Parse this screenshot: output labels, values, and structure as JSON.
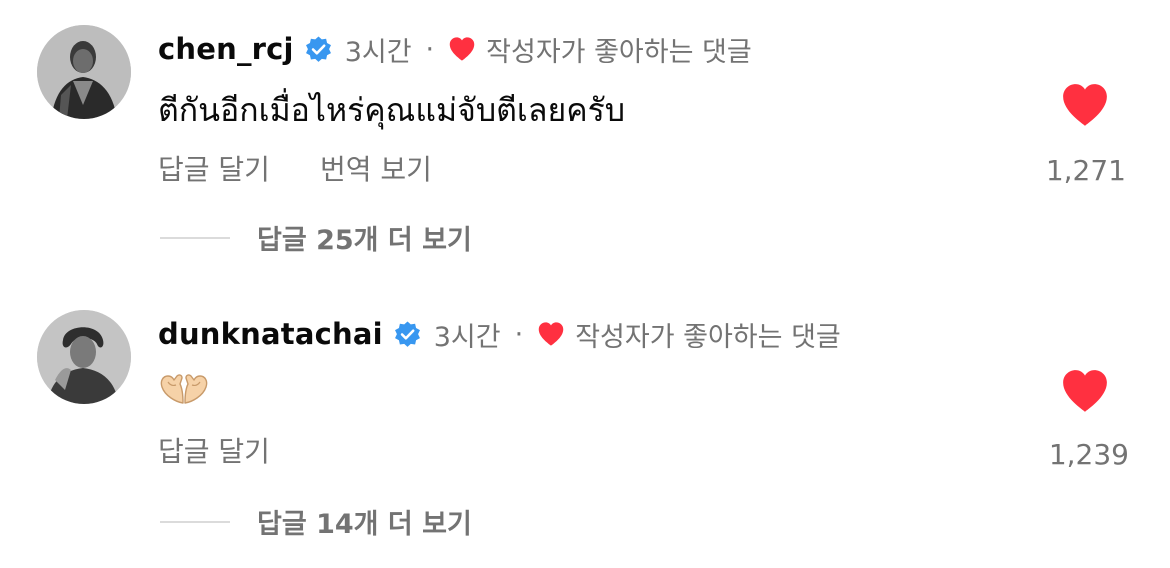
{
  "comments": [
    {
      "username": "chen_rcj",
      "time": "3시간",
      "separator": "·",
      "liked_by_author_label": "작성자가 좋아하는 댓글",
      "text": "ตีกันอีกเมื่อไหร่คุณแม่จับตีเลยครับ",
      "actions": [
        "답글 달기",
        "번역 보기"
      ],
      "like_count": "1,271",
      "view_replies_label": "답글 25개 더 보기",
      "avatar_icon": "avatar-photo-icon"
    },
    {
      "username": "dunknatachai",
      "time": "3시간",
      "separator": "·",
      "liked_by_author_label": "작성자가 좋아하는 댓글",
      "text_emoji": "heart-hands-emoji",
      "actions": [
        "답글 달기"
      ],
      "like_count": "1,239",
      "view_replies_label": "답글 14개 더 보기",
      "avatar_icon": "avatar-photo-icon"
    }
  ],
  "colors": {
    "verified_blue": "#3897f0",
    "heart_red": "#ff3040",
    "secondary_text": "#737373",
    "divider": "#dbdbdb"
  }
}
